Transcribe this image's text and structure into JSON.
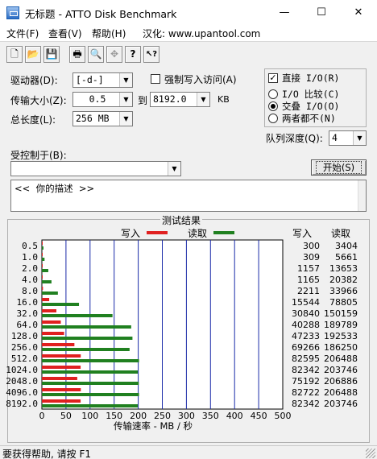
{
  "window": {
    "title": "无标题 - ATTO Disk Benchmark",
    "minimize": "—",
    "maximize": "☐",
    "close": "✕"
  },
  "menu": {
    "file": "文件(F)",
    "view": "查看(V)",
    "help": "帮助(H)",
    "localized": "汉化: www.upantool.com"
  },
  "toolbar": {
    "buttons": [
      {
        "name": "new-file-icon",
        "glyph": "🗋"
      },
      {
        "name": "open-folder-icon",
        "glyph": "📂"
      },
      {
        "name": "save-icon",
        "glyph": "💾"
      },
      {
        "name": "print-icon",
        "glyph": "🖶"
      },
      {
        "name": "print-preview-icon",
        "glyph": "🔍"
      },
      {
        "name": "move-icon",
        "glyph": "✥"
      },
      {
        "name": "help-icon",
        "glyph": "?"
      },
      {
        "name": "context-help-icon",
        "glyph": "↖?"
      }
    ]
  },
  "settings": {
    "drive_label": "驱动器(D):",
    "drive_value": "[-d-]",
    "transfer_label": "传输大小(Z):",
    "transfer_from": "0.5",
    "to_label": "到",
    "transfer_to": "8192.0",
    "transfer_unit": "KB",
    "length_label": "总长度(L):",
    "length_value": "256 MB",
    "force_write_label": "强制写入访问(A)",
    "direct_io_label": "直接 I/O(R)",
    "io_compare_label": "I/O 比较(C)",
    "overlapped_io_label": "交叠 I/O(O)",
    "neither_label": "两者都不(N)",
    "queue_label": "队列深度(Q):",
    "queue_value": "4",
    "controlled_by_label": "受控制于(B):",
    "controlled_by_value": "",
    "start_button": "开始(S)",
    "description_text": "<<  你的描述  >>"
  },
  "results": {
    "group_title": "测试结果",
    "legend_write": "写入",
    "legend_read": "读取",
    "col_write": "写入",
    "col_read": "读取",
    "xlabel": "传输速率 - MB / 秒"
  },
  "chart_data": {
    "type": "bar",
    "orientation": "horizontal",
    "title": "测试结果",
    "xlabel": "传输速率 - MB / 秒",
    "xlim": [
      0,
      500
    ],
    "x_ticks": [
      0,
      50,
      100,
      150,
      200,
      250,
      300,
      350,
      400,
      450,
      500
    ],
    "categories": [
      "0.5",
      "1.0",
      "2.0",
      "4.0",
      "8.0",
      "16.0",
      "32.0",
      "64.0",
      "128.0",
      "256.0",
      "512.0",
      "1024.0",
      "2048.0",
      "4096.0",
      "8192.0"
    ],
    "series": [
      {
        "name": "写入",
        "color": "#e02020",
        "values": [
          0.3,
          0.3,
          1.1,
          1.1,
          2.2,
          15.2,
          30.1,
          39.3,
          46.1,
          67.5,
          80.7,
          80.4,
          73.4,
          80.8,
          80.4
        ]
      },
      {
        "name": "读取",
        "color": "#208020",
        "values": [
          3.3,
          5.5,
          13.3,
          19.9,
          33.2,
          77.0,
          146.6,
          185.4,
          188.0,
          182.0,
          201.6,
          199.0,
          201.1,
          201.6,
          199.0
        ]
      }
    ],
    "table": {
      "write": [
        "300",
        "309",
        "1157",
        "1165",
        "2211",
        "15544",
        "30840",
        "40288",
        "47233",
        "69266",
        "82595",
        "82342",
        "75192",
        "82722",
        "82342"
      ],
      "read": [
        "3404",
        "5661",
        "13653",
        "20382",
        "33966",
        "78805",
        "150159",
        "189789",
        "192533",
        "186250",
        "206488",
        "203746",
        "206886",
        "206488",
        "203746"
      ]
    }
  },
  "status": {
    "text": "要获得帮助, 请按 F1"
  }
}
